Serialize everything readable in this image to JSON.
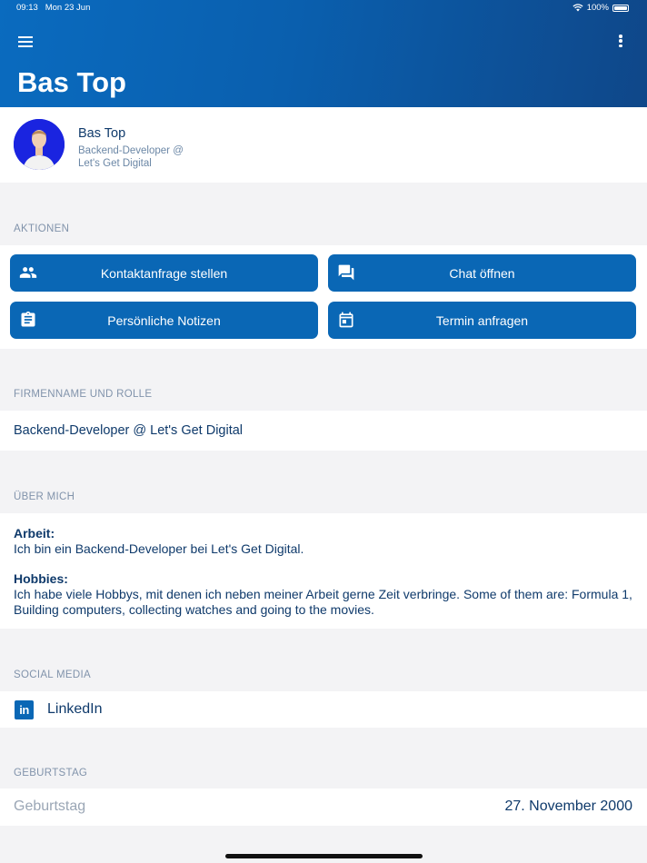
{
  "status_bar": {
    "time": "09:13",
    "date": "Mon 23 Jun",
    "battery": "100%"
  },
  "header": {
    "title": "Bas Top",
    "menu_icon": "menu-icon",
    "more_icon": "more-vertical-icon"
  },
  "profile": {
    "name": "Bas Top",
    "role_line1": "Backend-Developer @",
    "role_line2": "Let's Get Digital"
  },
  "actions": {
    "label": "AKTIONEN",
    "buttons": [
      {
        "label": "Kontaktanfrage stellen",
        "icon": "people-icon"
      },
      {
        "label": "Chat öffnen",
        "icon": "chat-icon"
      },
      {
        "label": "Persönliche Notizen",
        "icon": "clipboard-icon"
      },
      {
        "label": "Termin anfragen",
        "icon": "calendar-icon"
      }
    ]
  },
  "company": {
    "label": "FIRMENNAME UND ROLLE",
    "value": "Backend-Developer @ Let's Get Digital"
  },
  "about": {
    "label": "ÜBER MICH",
    "work_heading": "Arbeit:",
    "work_text": "Ich bin ein Backend-Developer bei Let's Get Digital.",
    "hobbies_heading": "Hobbies:",
    "hobbies_text": "Ich habe viele Hobbys, mit denen ich neben meiner Arbeit gerne Zeit verbringe. Some of them are: Formula 1, Building computers, collecting watches and going to the movies."
  },
  "social": {
    "label": "SOCIAL MEDIA",
    "linkedin": "LinkedIn",
    "linkedin_glyph": "in"
  },
  "birthday": {
    "label": "GEBURTSTAG",
    "field_label": "Geburtstag",
    "value": "27. November 2000"
  },
  "colors": {
    "primary": "#0a67b5",
    "header_dark": "#0f4789",
    "text": "#0f3a6b",
    "muted": "#8193ab",
    "background": "#f3f3f5"
  }
}
